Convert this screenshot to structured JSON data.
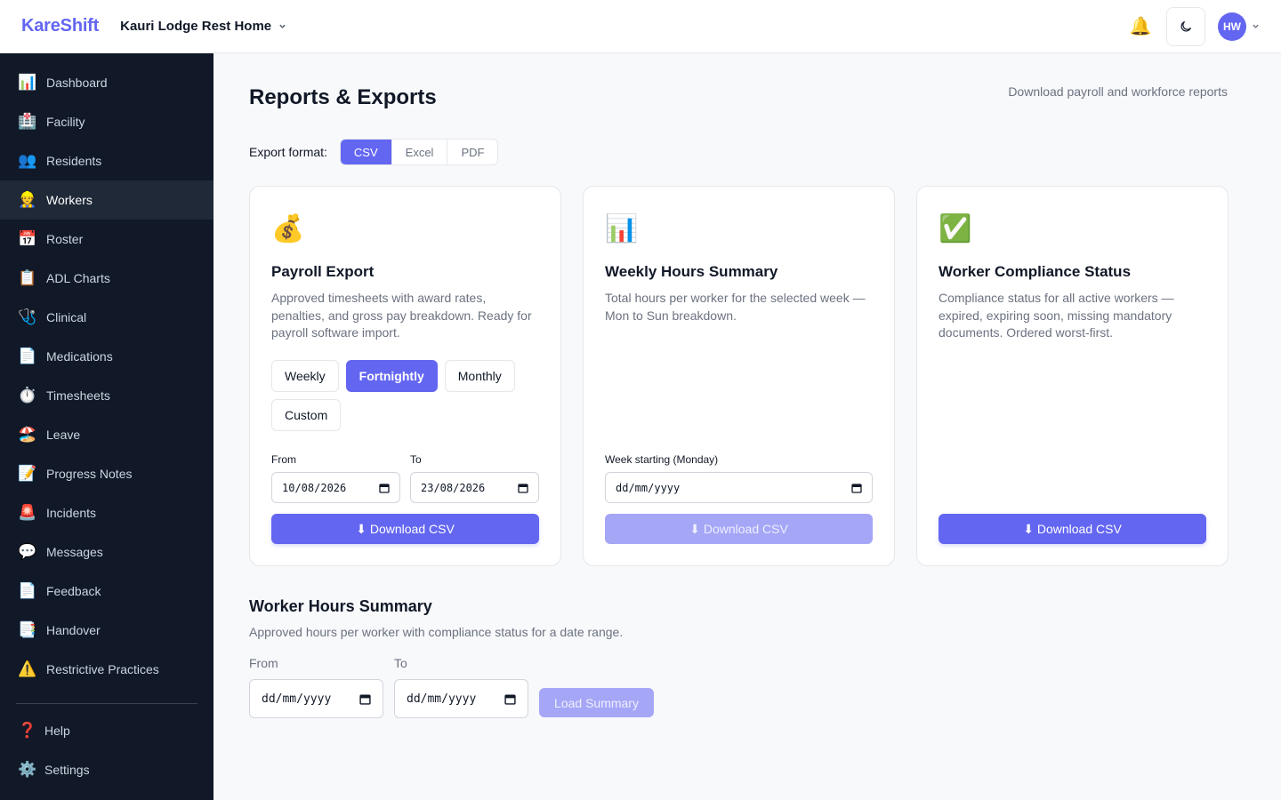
{
  "app": {
    "brand": "KareShift",
    "facility": "Kauri Lodge Rest Home",
    "user_initials": "HW"
  },
  "sidebar": {
    "items": [
      {
        "label": "Dashboard",
        "icon": "📊",
        "icon_name": "chart-icon"
      },
      {
        "label": "Facility",
        "icon": "🏥",
        "icon_name": "hospital-icon"
      },
      {
        "label": "Residents",
        "icon": "👥",
        "icon_name": "people-icon"
      },
      {
        "label": "Workers",
        "icon": "👷",
        "icon_name": "worker-icon",
        "active": true
      },
      {
        "label": "Roster",
        "icon": "📅",
        "icon_name": "calendar-icon"
      },
      {
        "label": "ADL Charts",
        "icon": "📋",
        "icon_name": "clipboard-icon"
      },
      {
        "label": "Clinical",
        "icon": "🩺",
        "icon_name": "stethoscope-icon"
      },
      {
        "label": "Medications",
        "icon": "📄",
        "icon_name": "document-icon"
      },
      {
        "label": "Timesheets",
        "icon": "⏱️",
        "icon_name": "stopwatch-icon"
      },
      {
        "label": "Leave",
        "icon": "🏖️",
        "icon_name": "beach-icon"
      },
      {
        "label": "Progress Notes",
        "icon": "📝",
        "icon_name": "memo-icon"
      },
      {
        "label": "Incidents",
        "icon": "🚨",
        "icon_name": "siren-icon"
      },
      {
        "label": "Messages",
        "icon": "💬",
        "icon_name": "speech-bubble-icon"
      },
      {
        "label": "Feedback",
        "icon": "📄",
        "icon_name": "document-icon"
      },
      {
        "label": "Handover",
        "icon": "📑",
        "icon_name": "bookmark-tabs-icon"
      },
      {
        "label": "Restrictive Practices",
        "icon": "⚠️",
        "icon_name": "warning-icon"
      }
    ],
    "bottom": [
      {
        "label": "Help",
        "icon": "❓",
        "icon_name": "question-icon"
      },
      {
        "label": "Settings",
        "icon": "⚙️",
        "icon_name": "gear-icon"
      }
    ]
  },
  "page": {
    "title": "Reports & Exports",
    "subtitle": "Download payroll and workforce reports",
    "format_label": "Export format:",
    "formats": [
      "CSV",
      "Excel",
      "PDF"
    ],
    "selected_format": "CSV"
  },
  "cards": {
    "payroll": {
      "icon": "💰",
      "title": "Payroll Export",
      "description": "Approved timesheets with award rates, penalties, and gross pay breakdown. Ready for payroll software import.",
      "periods": [
        "Weekly",
        "Fortnightly",
        "Monthly",
        "Custom"
      ],
      "selected_period": "Fortnightly",
      "from_label": "From",
      "to_label": "To",
      "from_value": "10/08/2026",
      "to_value": "23/08/2026",
      "button_label": "⬇ Download CSV"
    },
    "weekly": {
      "icon": "📊",
      "title": "Weekly Hours Summary",
      "description": "Total hours per worker for the selected week — Mon to Sun breakdown.",
      "week_label": "Week starting (Monday)",
      "week_value": "dd/mm/yyyy",
      "button_label": "⬇ Download CSV"
    },
    "compliance": {
      "icon": "✅",
      "title": "Worker Compliance Status",
      "description": "Compliance status for all active workers — expired, expiring soon, missing mandatory documents. Ordered worst-first.",
      "button_label": "⬇ Download CSV"
    }
  },
  "summary": {
    "title": "Worker Hours Summary",
    "description": "Approved hours per worker with compliance status for a date range.",
    "from_label": "From",
    "to_label": "To",
    "from_value": "dd/mm/yyyy",
    "to_value": "dd/mm/yyyy",
    "button_label": "Load Summary"
  },
  "colors": {
    "accent": "#6366f1",
    "accent_disabled": "#a5a6f6",
    "sidebar_bg": "#111827"
  }
}
